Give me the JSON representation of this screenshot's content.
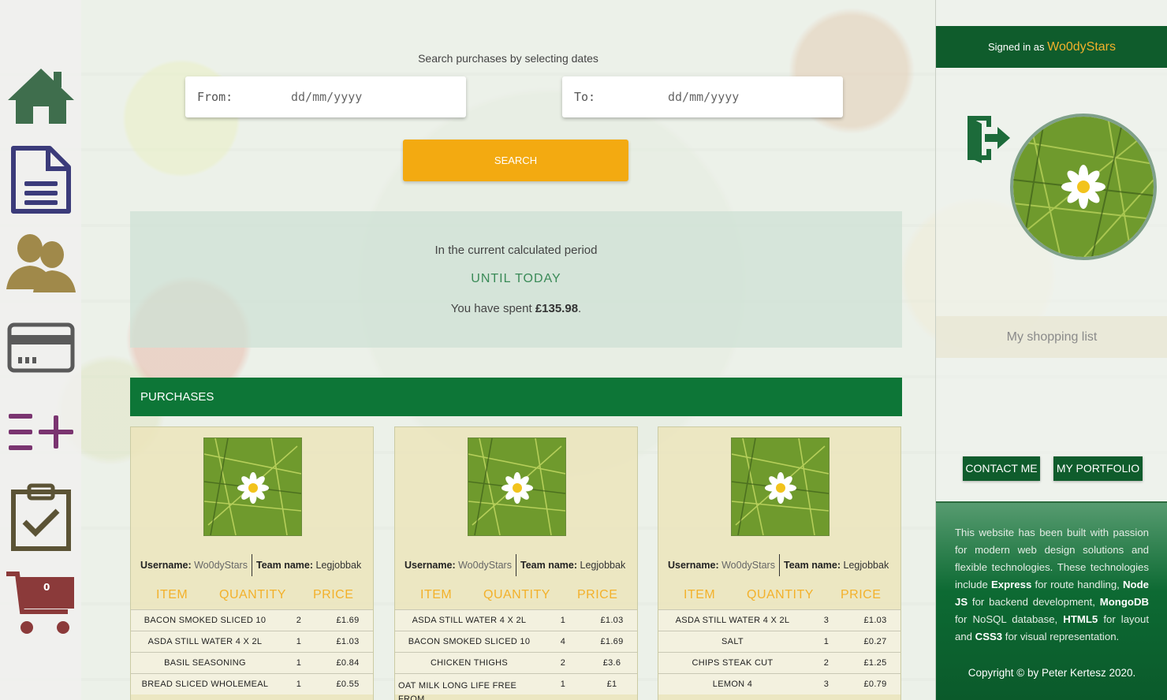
{
  "search": {
    "caption": "Search purchases by selecting dates",
    "from_label": "From:",
    "to_label": "To:",
    "date_placeholder": "dd/mm/yyyy",
    "button_label": "SEARCH"
  },
  "summary": {
    "line1": "In the current calculated period",
    "period": "UNTIL TODAY",
    "spent_prefix": "You have spent ",
    "spent_amount": "£135.98",
    "spent_suffix": "."
  },
  "purchases": {
    "header": "PURCHASES",
    "col_item": "ITEM",
    "col_quantity": "QUANTITY",
    "col_price": "PRICE",
    "username_label": "Username:",
    "teamname_label": "Team name:",
    "cards": [
      {
        "username": "Wo0dyStars",
        "team": "Legjobbak",
        "rows": [
          {
            "item": "BACON SMOKED SLICED 10",
            "qty": "2",
            "price": "£1.69"
          },
          {
            "item": "ASDA STILL WATER 4 X 2L",
            "qty": "1",
            "price": "£1.03"
          },
          {
            "item": "BASIL SEASONING",
            "qty": "1",
            "price": "£0.84"
          },
          {
            "item": "BREAD SLICED WHOLEMEAL",
            "qty": "1",
            "price": "£0.55"
          }
        ]
      },
      {
        "username": "Wo0dyStars",
        "team": "Legjobbak",
        "rows": [
          {
            "item": "ASDA STILL WATER 4 X 2L",
            "qty": "1",
            "price": "£1.03"
          },
          {
            "item": "BACON SMOKED SLICED 10",
            "qty": "4",
            "price": "£1.69"
          },
          {
            "item": "CHICKEN THIGHS",
            "qty": "2",
            "price": "£3.6"
          },
          {
            "item": "OAT MILK LONG LIFE FREE FROM",
            "qty": "1",
            "price": "£1"
          }
        ]
      },
      {
        "username": "Wo0dyStars",
        "team": "Legjobbak",
        "rows": [
          {
            "item": "ASDA STILL WATER 4 X 2L",
            "qty": "3",
            "price": "£1.03"
          },
          {
            "item": "SALT",
            "qty": "1",
            "price": "£0.27"
          },
          {
            "item": "CHIPS STEAK CUT",
            "qty": "2",
            "price": "£1.25"
          },
          {
            "item": "LEMON 4",
            "qty": "3",
            "price": "£0.79"
          }
        ]
      }
    ]
  },
  "nav": {
    "items": [
      "home-icon",
      "document-icon",
      "users-icon",
      "credit-card-icon",
      "add-list-icon",
      "clipboard-check-icon",
      "cart-icon"
    ],
    "cart_count": "0"
  },
  "sidebar": {
    "signed_in_prefix": "Signed in as ",
    "username": "Wo0dyStars",
    "shopping_list": "My shopping list",
    "contact_label": "CONTACT ME",
    "portfolio_label": "MY PORTFOLIO",
    "footer_copyright": "Copyright © by Peter Kertesz 2020."
  },
  "colors": {
    "brand_green": "#0d7637",
    "dark_green": "#0f5c2c",
    "accent_orange": "#f3aa11"
  }
}
